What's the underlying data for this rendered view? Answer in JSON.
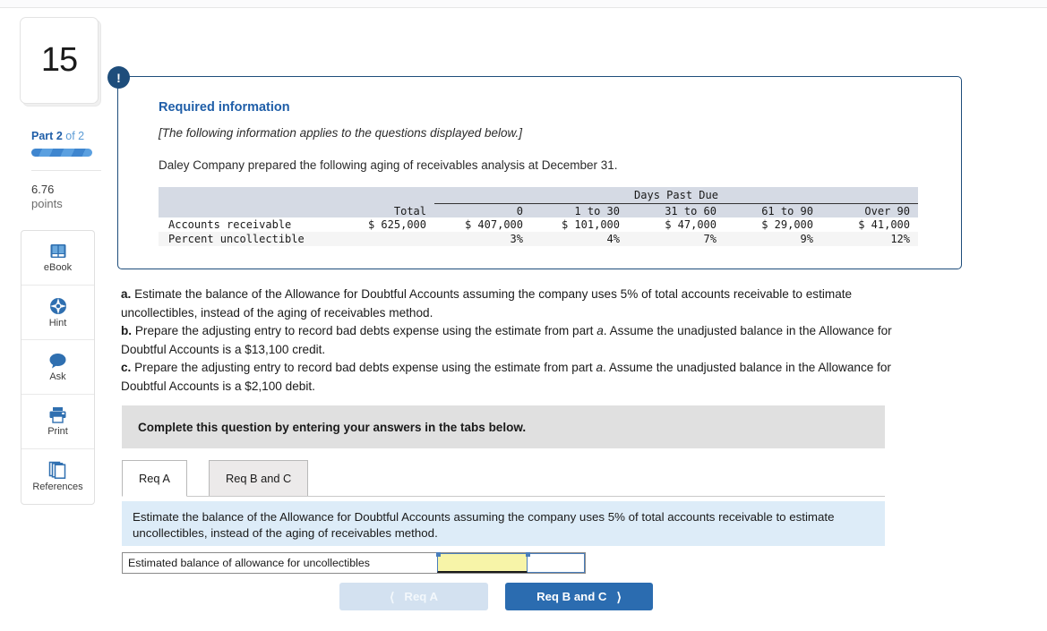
{
  "sidebar": {
    "question_number": "15",
    "part_label_prefix": "Part",
    "part_number": "2",
    "part_of": "of 2",
    "points_value": "6.76",
    "points_label": "points",
    "tools": [
      {
        "label": "eBook",
        "icon": "book-icon"
      },
      {
        "label": "Hint",
        "icon": "lifebuoy-icon"
      },
      {
        "label": "Ask",
        "icon": "chat-bubble-icon"
      },
      {
        "label": "Print",
        "icon": "printer-icon"
      },
      {
        "label": "References",
        "icon": "copy-pages-icon"
      }
    ]
  },
  "callout": {
    "badge_icon": "exclamation-icon",
    "title": "Required information",
    "italic_note": "[The following information applies to the questions displayed below.]",
    "description": "Daley Company prepared the following aging of receivables analysis at December 31."
  },
  "chart_data": {
    "type": "table",
    "title": "Aging of receivables analysis",
    "group_header": "Days Past Due",
    "columns": [
      "",
      "Total",
      "0",
      "1 to 30",
      "31 to 60",
      "61 to 90",
      "Over 90"
    ],
    "rows": [
      {
        "label": "Accounts receivable",
        "values": [
          "$ 625,000",
          "$ 407,000",
          "$ 101,000",
          "$ 47,000",
          "$ 29,000",
          "$ 41,000"
        ]
      },
      {
        "label": "Percent uncollectible",
        "values": [
          "",
          "3%",
          "4%",
          "7%",
          "9%",
          "12%"
        ]
      }
    ]
  },
  "questions": {
    "a_marker": "a.",
    "a_text": " Estimate the balance of the Allowance for Doubtful Accounts assuming the company uses 5% of total accounts receivable to estimate uncollectibles, instead of the aging of receivables method.",
    "b_marker": "b.",
    "b_text_1": " Prepare the adjusting entry to record bad debts expense using the estimate from part ",
    "b_italic": "a",
    "b_text_2": ". Assume the unadjusted balance in the Allowance for Doubtful Accounts is a $13,100 credit.",
    "c_marker": "c.",
    "c_text_1": " Prepare the adjusting entry to record bad debts expense using the estimate from part ",
    "c_italic": "a",
    "c_text_2": ". Assume the unadjusted balance in the Allowance for Doubtful Accounts is a $2,100 debit."
  },
  "complete_bar": {
    "text": "Complete this question by entering your answers in the tabs below."
  },
  "tabs": [
    {
      "label": "Req A",
      "active": true
    },
    {
      "label": "Req B and C",
      "active": false
    }
  ],
  "instruction_panel": {
    "text": "Estimate the balance of the Allowance for Doubtful Accounts assuming the company uses 5% of total accounts receivable to estimate uncollectibles, instead of the aging of receivables method."
  },
  "answer_row": {
    "label": "Estimated balance of allowance for uncollectibles",
    "value_primary": "",
    "value_secondary": ""
  },
  "nav": {
    "prev_label": "Req A",
    "prev_icon": "chevron-left-icon",
    "next_label": "Req B and C",
    "next_icon": "chevron-right-icon"
  },
  "colors": {
    "accent_blue": "#2b6cb0",
    "callout_border": "#1e4d7b",
    "table_header_bg": "#d5dae4",
    "panel_blue": "#ddecf8",
    "input_yellow": "#f7f4a8"
  }
}
